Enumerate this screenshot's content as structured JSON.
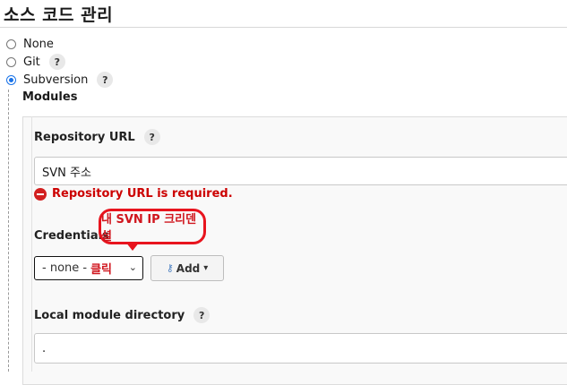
{
  "page": {
    "title": "소스 코드 관리"
  },
  "scm_options": [
    {
      "label": "None",
      "selected": false,
      "help": false
    },
    {
      "label": "Git",
      "selected": false,
      "help": true
    },
    {
      "label": "Subversion",
      "selected": true,
      "help": true
    }
  ],
  "help_glyph": "?",
  "modules": {
    "label": "Modules",
    "repository_url": {
      "label": "Repository URL",
      "value": "SVN 주소",
      "error": "Repository URL is required."
    },
    "credentials": {
      "label": "Credentials",
      "select_value": "- none -",
      "select_note": "클릭",
      "caret": "⌄",
      "add_label": "Add",
      "add_caret": "▾",
      "annotation": "내 SVN IP 크리덴셜"
    },
    "local_module_directory": {
      "label": "Local module directory",
      "value": "."
    }
  },
  "colors": {
    "error": "#d21f1f",
    "annotation": "#e8141e",
    "radio_selected": "#1a73e8"
  }
}
